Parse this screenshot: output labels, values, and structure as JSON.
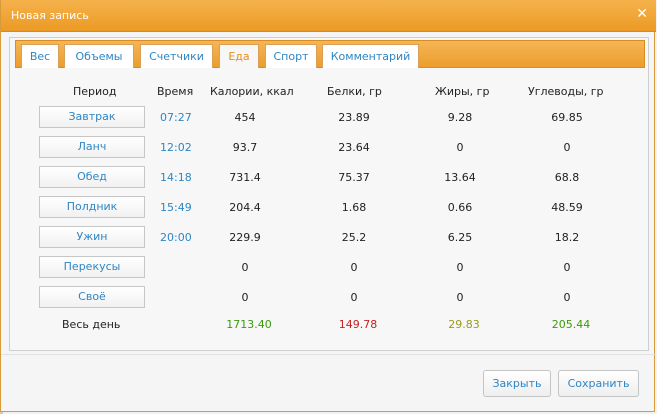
{
  "dialog": {
    "title": "Новая запись",
    "close_icon": "close-icon"
  },
  "tabs": [
    {
      "label": "Вес",
      "active": false
    },
    {
      "label": "Объемы",
      "active": false
    },
    {
      "label": "Счетчики",
      "active": false
    },
    {
      "label": "Еда",
      "active": true
    },
    {
      "label": "Спорт",
      "active": false
    },
    {
      "label": "Комментарий",
      "active": false
    }
  ],
  "table": {
    "headers": [
      "Период",
      "Время",
      "Калории, ккал",
      "Белки, гр",
      "Жиры, гр",
      "Углеводы, гр"
    ],
    "rows": [
      {
        "period": "Завтрак",
        "time": "07:27",
        "calories": "454",
        "protein": "23.89",
        "fat": "9.28",
        "carbs": "69.85"
      },
      {
        "period": "Ланч",
        "time": "12:02",
        "calories": "93.7",
        "protein": "23.64",
        "fat": "0",
        "carbs": "0"
      },
      {
        "period": "Обед",
        "time": "14:18",
        "calories": "731.4",
        "protein": "75.37",
        "fat": "13.64",
        "carbs": "68.8"
      },
      {
        "period": "Полдник",
        "time": "15:49",
        "calories": "204.4",
        "protein": "1.68",
        "fat": "0.66",
        "carbs": "48.59"
      },
      {
        "period": "Ужин",
        "time": "20:00",
        "calories": "229.9",
        "protein": "25.2",
        "fat": "6.25",
        "carbs": "18.2"
      },
      {
        "period": "Перекусы",
        "time": "",
        "calories": "0",
        "protein": "0",
        "fat": "0",
        "carbs": "0"
      },
      {
        "period": "Своё",
        "time": "",
        "calories": "0",
        "protein": "0",
        "fat": "0",
        "carbs": "0"
      }
    ],
    "total": {
      "label": "Весь день",
      "calories": "1713.40",
      "protein": "149.78",
      "fat": "29.83",
      "carbs": "205.44"
    }
  },
  "colors": {
    "total_calories": "#3a9a0a",
    "total_protein": "#c81f1f",
    "total_fat": "#9a9a1a",
    "total_carbs": "#3a9a0a",
    "link": "#2e86c4",
    "accent": "#ec9d2c"
  },
  "footer": {
    "close_label": "Закрыть",
    "save_label": "Сохранить"
  }
}
